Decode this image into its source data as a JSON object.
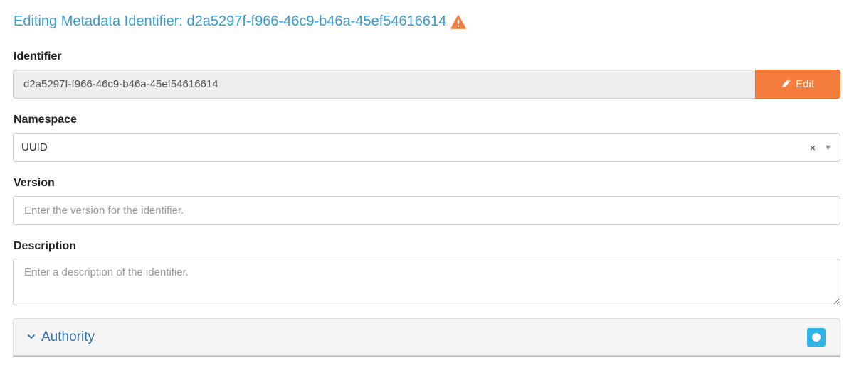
{
  "header": {
    "title": "Editing Metadata Identifier: d2a5297f-f966-46c9-b46a-45ef54616614",
    "warning_icon": "warning-triangle-icon",
    "warning_color": "#f47c3c"
  },
  "identifier": {
    "label": "Identifier",
    "value": "d2a5297f-f966-46c9-b46a-45ef54616614",
    "edit_label": "Edit",
    "edit_icon": "pencil-icon"
  },
  "namespace": {
    "label": "Namespace",
    "value": "UUID",
    "clear": "×",
    "arrow": "▼"
  },
  "version": {
    "label": "Version",
    "placeholder": "Enter the version for the identifier."
  },
  "description": {
    "label": "Description",
    "placeholder": "Enter a description of the identifier."
  },
  "authority": {
    "label": "Authority",
    "chevron_icon": "chevron-down-icon",
    "badge_icon": "circle-icon"
  },
  "colors": {
    "title": "#3a9bd2",
    "edit_button": "#f47c3c",
    "panel_title": "#2e6fa7",
    "badge": "#2db3e8"
  }
}
